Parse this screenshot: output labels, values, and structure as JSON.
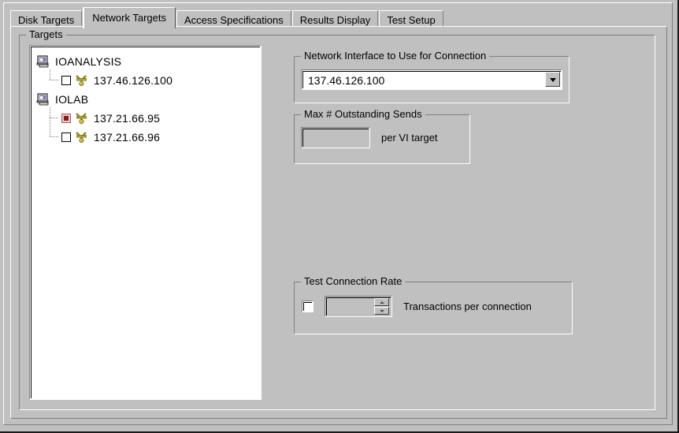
{
  "window": {
    "background_color": "#c0c0c0"
  },
  "tabs": [
    {
      "label": "Disk Targets",
      "selected": false
    },
    {
      "label": "Network Targets",
      "selected": true
    },
    {
      "label": "Access Specifications",
      "selected": false
    },
    {
      "label": "Results Display",
      "selected": false
    },
    {
      "label": "Test Setup",
      "selected": false
    }
  ],
  "targets_group": {
    "label": "Targets",
    "tree": [
      {
        "type": "host",
        "label": "IOANALYSIS",
        "icon": "computer-icon",
        "children": [
          {
            "type": "interface",
            "label": "137.46.126.100",
            "icon": "vi-connector-icon",
            "checked": false,
            "last": true
          }
        ]
      },
      {
        "type": "host",
        "label": "IOLAB",
        "icon": "computer-icon",
        "children": [
          {
            "type": "interface",
            "label": "137.21.66.95",
            "icon": "vi-connector-icon",
            "checked": true,
            "last": false
          },
          {
            "type": "interface",
            "label": "137.21.66.96",
            "icon": "vi-connector-icon",
            "checked": false,
            "last": true
          }
        ]
      }
    ]
  },
  "network_interface_group": {
    "label": "Network Interface to Use for Connection",
    "combo": {
      "value": "137.46.126.100",
      "arrow_icon": "chevron-down-icon"
    }
  },
  "max_outstanding_sends_group": {
    "label": "Max # Outstanding Sends",
    "input_value": "",
    "input_placeholder": "",
    "suffix_label": "per VI target",
    "enabled": false
  },
  "test_connection_rate_group": {
    "label": "Test Connection Rate",
    "checkbox_checked": false,
    "spinner_value": "",
    "spinner_up_icon": "spinner-up-icon",
    "spinner_down_icon": "spinner-down-icon",
    "suffix_label": "Transactions per connection",
    "enabled": false
  },
  "colors": {
    "face": "#c0c0c0",
    "field": "#ffffff",
    "shadow": "#808080",
    "highlight": "#ffffff",
    "text": "#000000",
    "selected_check": "#8b1a1a",
    "vi_icon": "#9a8f23"
  }
}
